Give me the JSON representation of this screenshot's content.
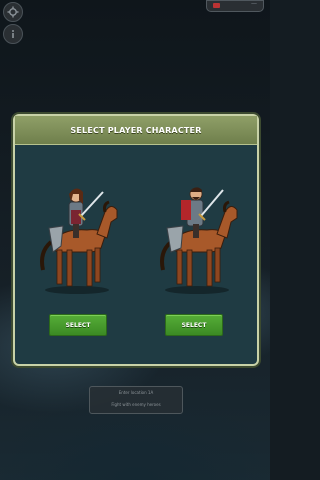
{
  "modal": {
    "title": "SELECT PLAYER CHARACTER",
    "characters": [
      {
        "select_label": "SELECT",
        "gender": "female"
      },
      {
        "select_label": "SELECT",
        "gender": "male"
      }
    ]
  },
  "background_panel": {
    "line1": "Enter location 1A",
    "line2": "Fight with enemy heroes"
  },
  "icons": {
    "settings": "gear-icon",
    "info": "info-icon"
  },
  "colors": {
    "header": "#7f8f58",
    "modal_bg": "#1f3b43",
    "select_button": "#4a9e2e"
  }
}
